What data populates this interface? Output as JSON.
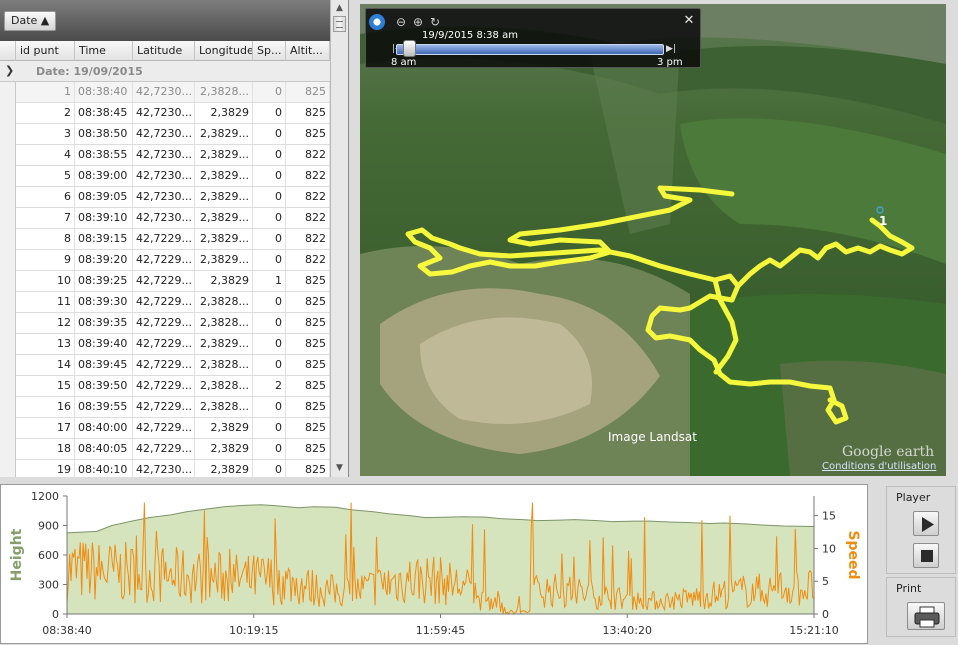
{
  "grid": {
    "group_chip": "Date ▲",
    "columns": [
      "id punt",
      "Time",
      "Latitude",
      "Longitude",
      "Sp...",
      "Altit..."
    ],
    "group_row": "Date: 19/09/2015",
    "rows": [
      [
        "1",
        "08:38:40",
        "42,7230...",
        "2,3828...",
        "0",
        "825"
      ],
      [
        "2",
        "08:38:45",
        "42,7230...",
        "2,3829",
        "0",
        "825"
      ],
      [
        "3",
        "08:38:50",
        "42,7230...",
        "2,3829...",
        "0",
        "825"
      ],
      [
        "4",
        "08:38:55",
        "42,7230...",
        "2,3829...",
        "0",
        "822"
      ],
      [
        "5",
        "08:39:00",
        "42,7230...",
        "2,3829...",
        "0",
        "822"
      ],
      [
        "6",
        "08:39:05",
        "42,7230...",
        "2,3829...",
        "0",
        "822"
      ],
      [
        "7",
        "08:39:10",
        "42,7230...",
        "2,3829...",
        "0",
        "822"
      ],
      [
        "8",
        "08:39:15",
        "42,7229...",
        "2,3829...",
        "0",
        "822"
      ],
      [
        "9",
        "08:39:20",
        "42,7229...",
        "2,3829...",
        "0",
        "822"
      ],
      [
        "10",
        "08:39:25",
        "42,7229...",
        "2,3829",
        "1",
        "825"
      ],
      [
        "11",
        "08:39:30",
        "42,7229...",
        "2,3828...",
        "0",
        "825"
      ],
      [
        "12",
        "08:39:35",
        "42,7229...",
        "2,3828...",
        "0",
        "825"
      ],
      [
        "13",
        "08:39:40",
        "42,7229...",
        "2,3829...",
        "0",
        "825"
      ],
      [
        "14",
        "08:39:45",
        "42,7229...",
        "2,3828...",
        "0",
        "825"
      ],
      [
        "15",
        "08:39:50",
        "42,7229...",
        "2,3828...",
        "2",
        "825"
      ],
      [
        "16",
        "08:39:55",
        "42,7229...",
        "2,3828...",
        "0",
        "825"
      ],
      [
        "17",
        "08:40:00",
        "42,7229...",
        "2,3829",
        "0",
        "825"
      ],
      [
        "18",
        "08:40:05",
        "42,7229...",
        "2,3829",
        "0",
        "825"
      ],
      [
        "19",
        "08:40:10",
        "42,7230...",
        "2,3829",
        "0",
        "825"
      ]
    ]
  },
  "map": {
    "time_control": {
      "date_time": "19/9/2015   8:38 am",
      "start_label": "8 am",
      "end_label": "3 pm",
      "position": 0.05
    },
    "attribution": "Image Landsat",
    "logo": "Google earth",
    "terms_link": "Conditions d'utilisation",
    "marker_label": "1"
  },
  "chart_data": {
    "type": "area",
    "x_ticks": [
      "08:38:40",
      "10:19:15",
      "11:59:45",
      "13:40:20",
      "15:21:10"
    ],
    "left_axis": {
      "label": "Height",
      "range": [
        0,
        1200
      ],
      "ticks": [
        "0",
        "300",
        "600",
        "900",
        "1200"
      ]
    },
    "right_axis": {
      "label": "Speed",
      "range": [
        0,
        18
      ],
      "ticks": [
        "0",
        "5",
        "10",
        "15"
      ]
    },
    "series": [
      {
        "name": "Height",
        "kind": "area",
        "color": "#d6e4be",
        "line_color": "#7d9468",
        "x": [
          0,
          0.04,
          0.06,
          0.09,
          0.11,
          0.14,
          0.16,
          0.19,
          0.21,
          0.24,
          0.26,
          0.28,
          0.31,
          0.33,
          0.36,
          0.38,
          0.41,
          0.43,
          0.46,
          0.48,
          0.51,
          0.53,
          0.56,
          0.58,
          0.61,
          0.63,
          0.66,
          0.68,
          0.71,
          0.73,
          0.76,
          0.78,
          0.81,
          0.83,
          0.86,
          0.88,
          0.91,
          0.93,
          0.96,
          1.0
        ],
        "values": [
          825,
          840,
          900,
          950,
          980,
          1010,
          1040,
          1070,
          1090,
          1105,
          1110,
          1100,
          1080,
          1090,
          1085,
          1060,
          1040,
          1020,
          1000,
          980,
          985,
          990,
          985,
          970,
          960,
          950,
          955,
          960,
          950,
          940,
          945,
          945,
          935,
          930,
          920,
          925,
          915,
          905,
          895,
          890
        ]
      },
      {
        "name": "Speed",
        "kind": "line",
        "color": "#f08c10"
      }
    ]
  },
  "player": {
    "title": "Player",
    "print_title": "Print"
  },
  "colors": {
    "track": "#ffff40",
    "height_fill": "#d6e4be",
    "speed": "#f08c10",
    "axis_label": "#86a06a"
  }
}
